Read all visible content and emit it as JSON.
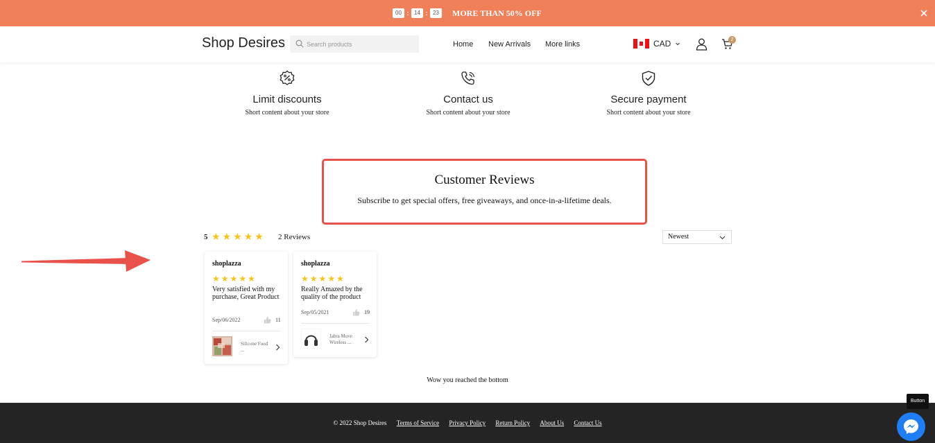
{
  "announcement": {
    "timer": [
      "00",
      "14",
      "23"
    ],
    "separator": ":",
    "text": "MORE THAN 50% OFF",
    "close_icon": "close-icon",
    "background_color": "#f08059"
  },
  "header": {
    "logo": "Shop Desires",
    "search_placeholder": "Search products",
    "nav": [
      "Home",
      "New Arrivals",
      "More links"
    ],
    "currency": "CAD",
    "cart_count": "2",
    "badge_color": "#c79a63"
  },
  "features": [
    {
      "icon": "percent-badge-icon",
      "title": "Limit discounts",
      "desc": "Short content about your store"
    },
    {
      "icon": "phone-call-icon",
      "title": "Contact us",
      "desc": "Short content about your store"
    },
    {
      "icon": "shield-check-icon",
      "title": "Secure payment",
      "desc": "Short content about your store"
    }
  ],
  "reviews": {
    "title": "Customer Reviews",
    "subtitle": "Subscribe to get special offers, free giveaways, and once-in-a-lifetime deals.",
    "highlight_color": "#e8524a",
    "rating": "5",
    "rating_stars": 5,
    "count_label": "2 Reviews",
    "sort_value": "Newest",
    "items": [
      {
        "author": "shoplazza",
        "stars": 5,
        "text": "Very satisfied with my purchase, Great Product",
        "date": "Sep/06/2022",
        "likes": "11",
        "product": "Silicone Food ..."
      },
      {
        "author": "shoplazza",
        "stars": 5,
        "text": "Really Amazed by the quality of the product",
        "date": "Sep/05/2021",
        "likes": "19",
        "product": "Jabra Move Wireless ..."
      }
    ],
    "end_message": "Wow you reached the bottom"
  },
  "footer": {
    "copyright": "© 2022 Shop Desires",
    "links": [
      "Terms of Service",
      "Privacy Policy",
      "Return Policy",
      "About Us",
      "Contact Us"
    ]
  },
  "floating": {
    "tooltip": "Button",
    "chat_icon": "messenger-icon",
    "chat_color": "#1f7ef5"
  },
  "annotation": {
    "arrow_color": "#e8524a"
  }
}
